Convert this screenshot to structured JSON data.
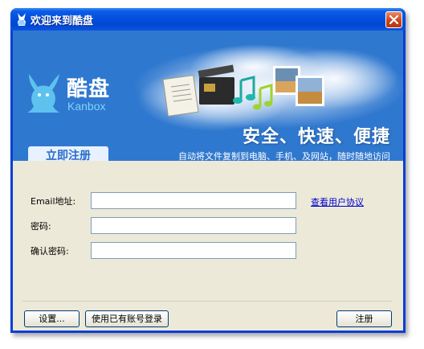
{
  "window": {
    "title": "欢迎来到酷盘"
  },
  "banner": {
    "logo_cn": "酷盘",
    "logo_en": "Kanbox",
    "slogan": "安全、快速、便捷",
    "sub_slogan": "自动将文件复制到电脑、手机、及网站，随时随地访问",
    "tab_label": "立即注册"
  },
  "form": {
    "email_label": "Email地址:",
    "email_value": "",
    "password_label": "密码:",
    "password_value": "",
    "confirm_label": "确认密码:",
    "confirm_value": "",
    "agreement_link": "查看用户协议"
  },
  "buttons": {
    "settings": "设置...",
    "existing_login": "使用已有账号登录",
    "register": "注册"
  },
  "colors": {
    "titlebar": "#0350dd",
    "banner": "#2f78cf",
    "client_bg": "#ece9d8",
    "link": "#0000cc"
  }
}
